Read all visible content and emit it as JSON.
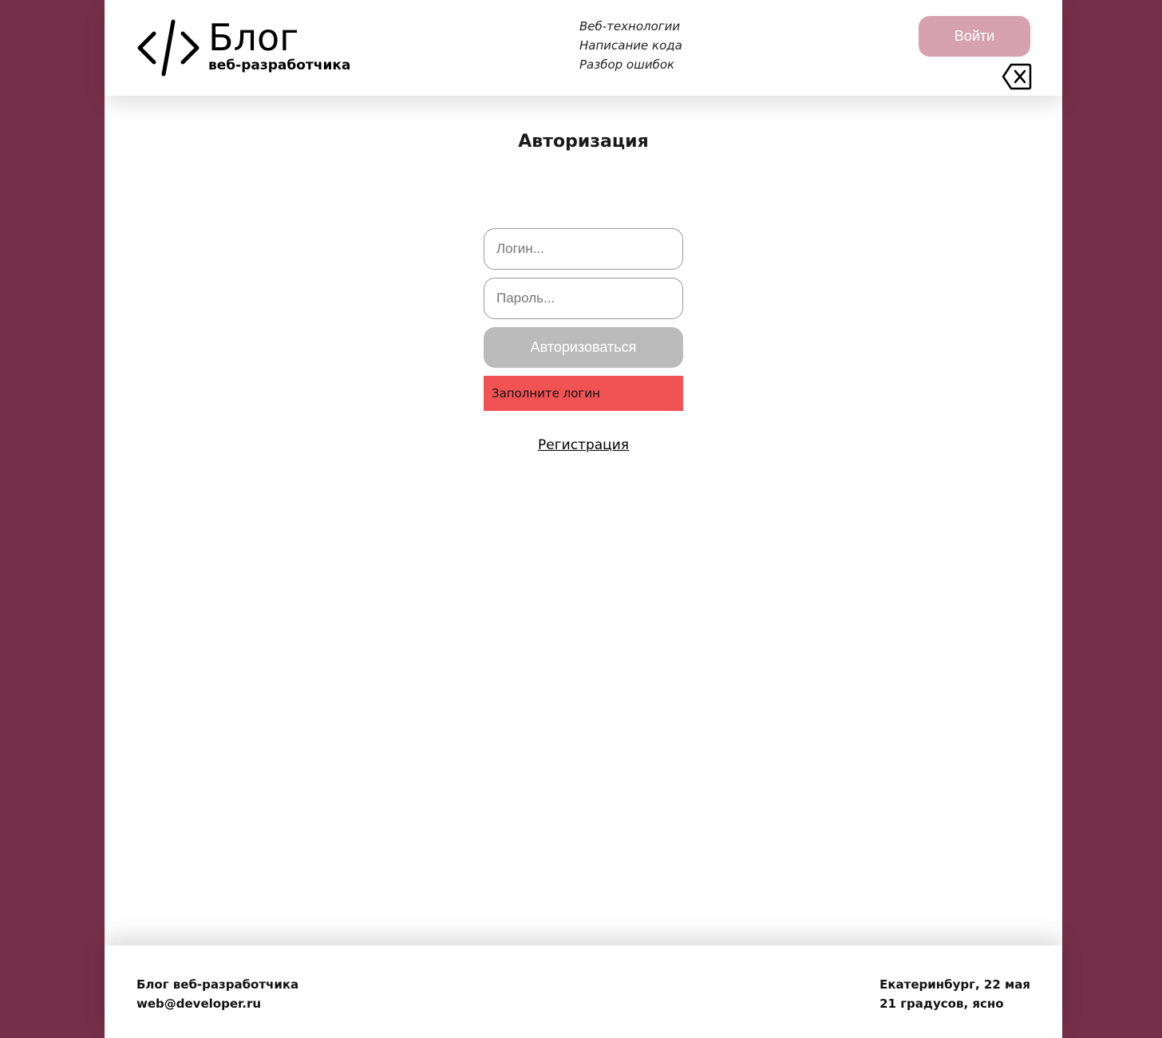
{
  "header": {
    "logo_title": "Блог",
    "logo_subtitle": "веб-разработчика",
    "nav": [
      {
        "label": "Веб-технологии"
      },
      {
        "label": "Написание кода"
      },
      {
        "label": "Разбор ошибок"
      }
    ],
    "login_button": "Войти",
    "back_icon": "backspace-x-icon"
  },
  "main": {
    "title": "Авторизация",
    "login_placeholder": "Логин...",
    "password_placeholder": "Пароль...",
    "submit_label": "Авторизоваться",
    "error_message": "Заполните логин",
    "register_link": "Регистрация"
  },
  "footer": {
    "left_line1": "Блог веб-разработчика",
    "left_line2": "web@developer.ru",
    "right_line1": "Екатеринбург, 22 мая",
    "right_line2": "21 градусов, ясно"
  },
  "colors": {
    "background": "#762f48",
    "login_button": "#d6a1b0",
    "submit_disabled": "#bbbbbb",
    "error": "#f15355"
  }
}
